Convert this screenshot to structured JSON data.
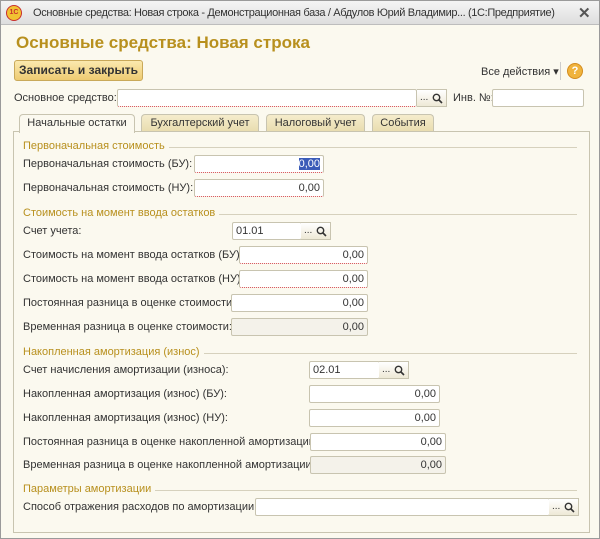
{
  "window": {
    "title": "Основные средства: Новая строка - Демонстрационная база / Абдулов Юрий Владимир... (1С:Предприятие)",
    "logo": "1С"
  },
  "form": {
    "title": "Основные средства: Новая строка"
  },
  "toolbar": {
    "save_close": "Записать и закрыть",
    "all_actions": "Все действия ▾",
    "help": "?"
  },
  "header": {
    "asset_label": "Основное средство:",
    "asset_value": "",
    "inv_label": "Инв. №:",
    "inv_value": "",
    "ellipsis": "..."
  },
  "tabs": [
    "Начальные остатки",
    "Бухгалтерский учет",
    "Налоговый учет",
    "События"
  ],
  "sections": {
    "s1": "Первоначальная стоимость",
    "s2": "Стоимость на момент ввода остатков",
    "s3": "Накопленная амортизация (износ)",
    "s4": "Параметры амортизации"
  },
  "fields": {
    "f1": {
      "label": "Первоначальная стоимость (БУ):",
      "value": "0,00"
    },
    "f2": {
      "label": "Первоначальная стоимость (НУ):",
      "value": "0,00"
    },
    "f3": {
      "label": "Счет учета:",
      "value": "01.01"
    },
    "f4": {
      "label": "Стоимость на момент ввода остатков (БУ):",
      "value": "0,00"
    },
    "f5": {
      "label": "Стоимость на момент ввода остатков (НУ):",
      "value": "0,00"
    },
    "f6": {
      "label": "Постоянная разница в оценке стоимости:",
      "value": "0,00"
    },
    "f7": {
      "label": "Временная разница в оценке стоимости:",
      "value": "0,00"
    },
    "f8": {
      "label": "Счет начисления амортизации (износа):",
      "value": "02.01"
    },
    "f9": {
      "label": "Накопленная амортизация (износ) (БУ):",
      "value": "0,00"
    },
    "f10": {
      "label": "Накопленная амортизация (износ) (НУ):",
      "value": "0,00"
    },
    "f11": {
      "label": "Постоянная разница в оценке накопленной амортизации:",
      "value": "0,00"
    },
    "f12": {
      "label": "Временная разница в оценке накопленной амортизации:",
      "value": "0,00"
    },
    "f13": {
      "label": "Способ отражения расходов по амортизации:",
      "value": ""
    }
  }
}
